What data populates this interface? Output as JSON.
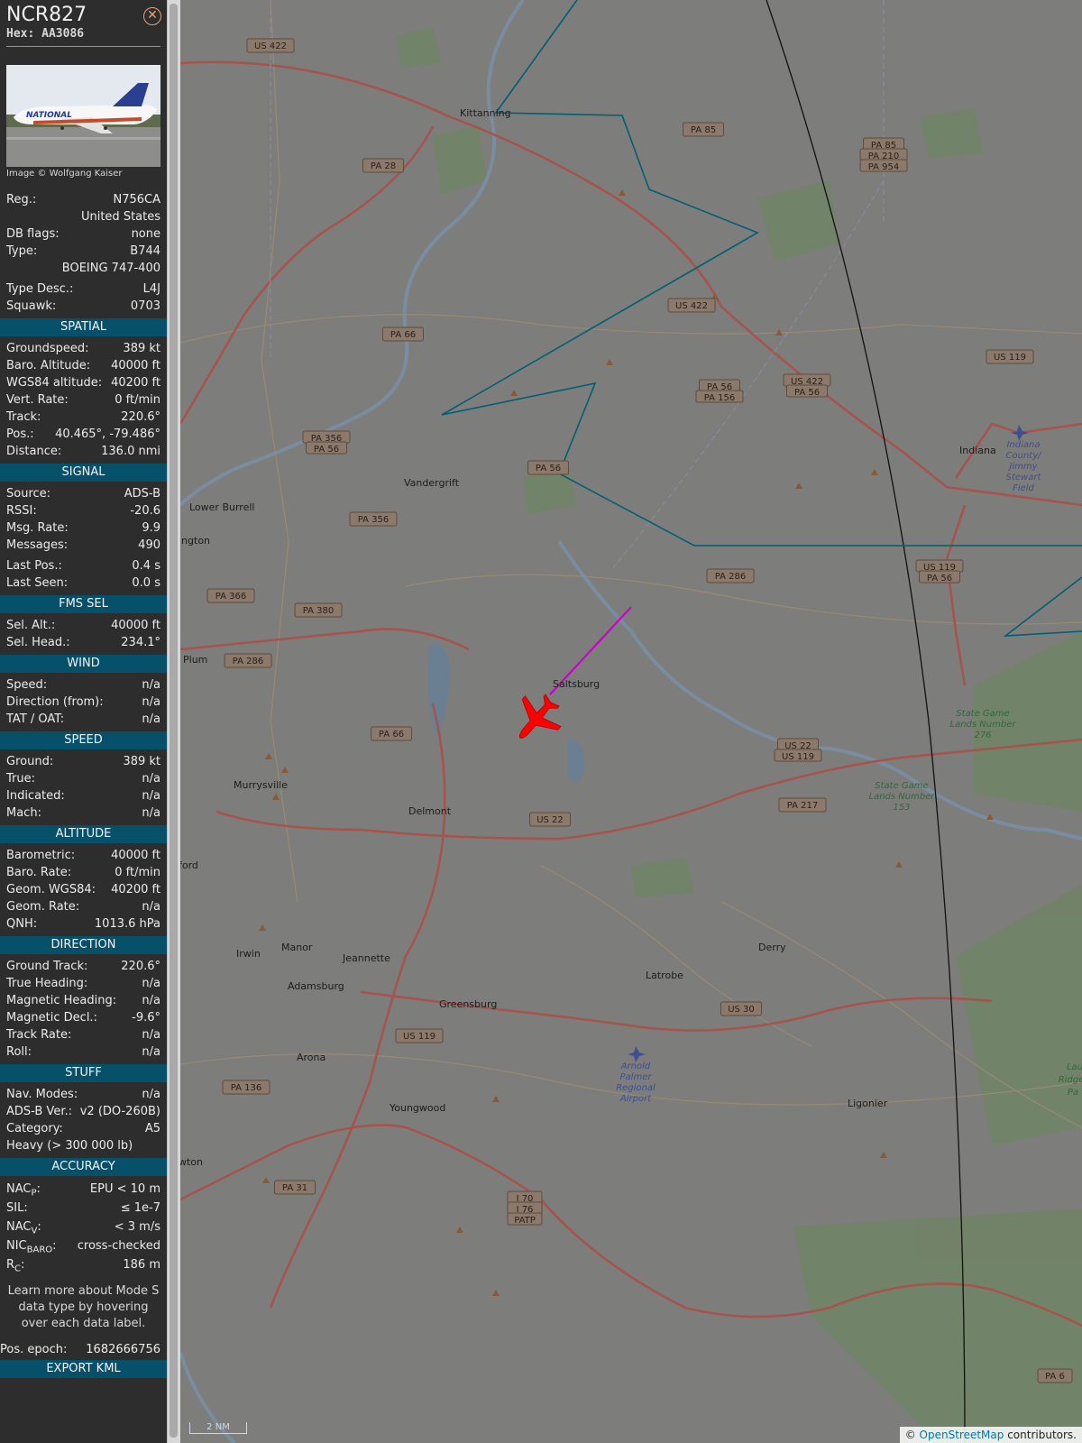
{
  "header": {
    "callsign": "NCR827",
    "hex_label": "Hex:",
    "hex": "AA3086",
    "photo_credit": "Image © Wolfgang Kaiser",
    "photo_brand": "NATIONAL"
  },
  "info": {
    "reg_label": "Reg.:",
    "reg": "N756CA",
    "country": "United States",
    "db_flags_label": "DB flags:",
    "db_flags": "none",
    "type_label": "Type:",
    "type": "B744",
    "type_full": "BOEING 747-400",
    "type_desc_label": "Type Desc.:",
    "type_desc": "L4J",
    "squawk_label": "Squawk:",
    "squawk": "0703"
  },
  "spatial": {
    "title": "SPATIAL",
    "rows": [
      {
        "label": "Groundspeed:",
        "value": "389 kt"
      },
      {
        "label": "Baro. Altitude:",
        "value": "40000 ft"
      },
      {
        "label": "WGS84 altitude:",
        "value": "40200 ft"
      },
      {
        "label": "Vert. Rate:",
        "value": "0 ft/min"
      },
      {
        "label": "Track:",
        "value": "220.6°"
      },
      {
        "label": "Pos.:",
        "value": "40.465°, -79.486°"
      },
      {
        "label": "Distance:",
        "value": "136.0 nmi"
      }
    ]
  },
  "signal": {
    "title": "SIGNAL",
    "rows": [
      {
        "label": "Source:",
        "value": "ADS-B"
      },
      {
        "label": "RSSI:",
        "value": "-20.6"
      },
      {
        "label": "Msg. Rate:",
        "value": "9.9"
      },
      {
        "label": "Messages:",
        "value": "490"
      },
      {
        "label": "Last Pos.:",
        "value": "0.4 s"
      },
      {
        "label": "Last Seen:",
        "value": "0.0 s"
      }
    ]
  },
  "fms": {
    "title": "FMS SEL",
    "rows": [
      {
        "label": "Sel. Alt.:",
        "value": "40000 ft"
      },
      {
        "label": "Sel. Head.:",
        "value": "234.1°"
      }
    ]
  },
  "wind": {
    "title": "WIND",
    "rows": [
      {
        "label": "Speed:",
        "value": "n/a"
      },
      {
        "label": "Direction (from):",
        "value": "n/a"
      },
      {
        "label": "TAT / OAT:",
        "value": "n/a"
      }
    ]
  },
  "speed": {
    "title": "SPEED",
    "rows": [
      {
        "label": "Ground:",
        "value": "389 kt"
      },
      {
        "label": "True:",
        "value": "n/a"
      },
      {
        "label": "Indicated:",
        "value": "n/a"
      },
      {
        "label": "Mach:",
        "value": "n/a"
      }
    ]
  },
  "altitude": {
    "title": "ALTITUDE",
    "rows": [
      {
        "label": "Barometric:",
        "value": "40000 ft"
      },
      {
        "label": "Baro. Rate:",
        "value": "0 ft/min"
      },
      {
        "label": "Geom. WGS84:",
        "value": "40200 ft"
      },
      {
        "label": "Geom. Rate:",
        "value": "n/a"
      },
      {
        "label": "QNH:",
        "value": "1013.6 hPa"
      }
    ]
  },
  "direction": {
    "title": "DIRECTION",
    "rows": [
      {
        "label": "Ground Track:",
        "value": "220.6°"
      },
      {
        "label": "True Heading:",
        "value": "n/a"
      },
      {
        "label": "Magnetic Heading:",
        "value": "n/a"
      },
      {
        "label": "Magnetic Decl.:",
        "value": "-9.6°"
      },
      {
        "label": "Track Rate:",
        "value": "n/a"
      },
      {
        "label": "Roll:",
        "value": "n/a"
      }
    ]
  },
  "stuff": {
    "title": "STUFF",
    "rows": [
      {
        "label": "Nav. Modes:",
        "value": "n/a"
      },
      {
        "label": "ADS-B Ver.:",
        "value": "v2 (DO-260B)"
      },
      {
        "label": "Category:",
        "value": "A5"
      }
    ],
    "category_desc": "Heavy (> 300 000 lb)"
  },
  "accuracy": {
    "title": "ACCURACY",
    "rows": [
      {
        "label": "NAC",
        "sub": "P",
        "value": "EPU < 10 m"
      },
      {
        "label": "SIL:",
        "sub": "",
        "value": "≤ 1e-7"
      },
      {
        "label": "NAC",
        "sub": "V",
        "value": "< 3 m/s"
      },
      {
        "label": "NIC",
        "sub": "BARO",
        "value": "cross-checked"
      },
      {
        "label": "R",
        "sub": "C",
        "value": "186 m"
      }
    ]
  },
  "footer": {
    "learn_more": "Learn more about Mode S data type by hovering over each data label.",
    "epoch_label": "Pos. epoch:",
    "epoch": "1682666756",
    "export": "EXPORT KML"
  },
  "map": {
    "scale_label": "2 NM",
    "attribution_prefix": "© ",
    "attribution_link": "OpenStreetMap",
    "attribution_suffix": " contributors.",
    "colors": {
      "background": "#7d7d7b",
      "route": "#005f73",
      "track": "#cc00cc",
      "aircraft": "#ff0000",
      "road": "#a8524c"
    },
    "road_shields": [
      "US 422",
      "PA 85",
      "PA 85",
      "PA 210",
      "PA 954",
      "PA 28",
      "US 422",
      "PA 66",
      "US 119",
      "PA 56",
      "PA 156",
      "US 422",
      "PA 56",
      "PA 56",
      "PA 356",
      "PA 56",
      "PA 356",
      "PA 286",
      "US 119",
      "PA 56",
      "PA 366",
      "PA 380",
      "PA 286",
      "PA 66",
      "US 22",
      "US 119",
      "US 22",
      "PA 217",
      "US 30",
      "US 119",
      "PA 136",
      "PA 31",
      "I 70",
      "I 76",
      "PATP",
      "PA 6"
    ],
    "places": [
      "Kittanning",
      "Indiana",
      "Vandergrift",
      "Lower Burrell",
      "Saltsburg",
      "Plum",
      "Murrysville",
      "Delmont",
      "Irwin",
      "Manor",
      "Jeannette",
      "Adamsburg",
      "Greensburg",
      "Latrobe",
      "Derry",
      "Arona",
      "Youngwood",
      "Ligonier",
      "ington",
      "ford",
      "wton"
    ],
    "airports": [
      [
        "Indiana",
        "County/",
        "Jimmy",
        "Stewart",
        "Field"
      ],
      [
        "Arnold",
        "Palmer",
        "Regional",
        "Airport"
      ]
    ],
    "parks": [
      [
        "State Game",
        "Lands Number",
        "276"
      ],
      [
        "State Game",
        "Lands Number",
        "153"
      ],
      [
        "Lau",
        "Ridge",
        "Pa"
      ]
    ]
  }
}
